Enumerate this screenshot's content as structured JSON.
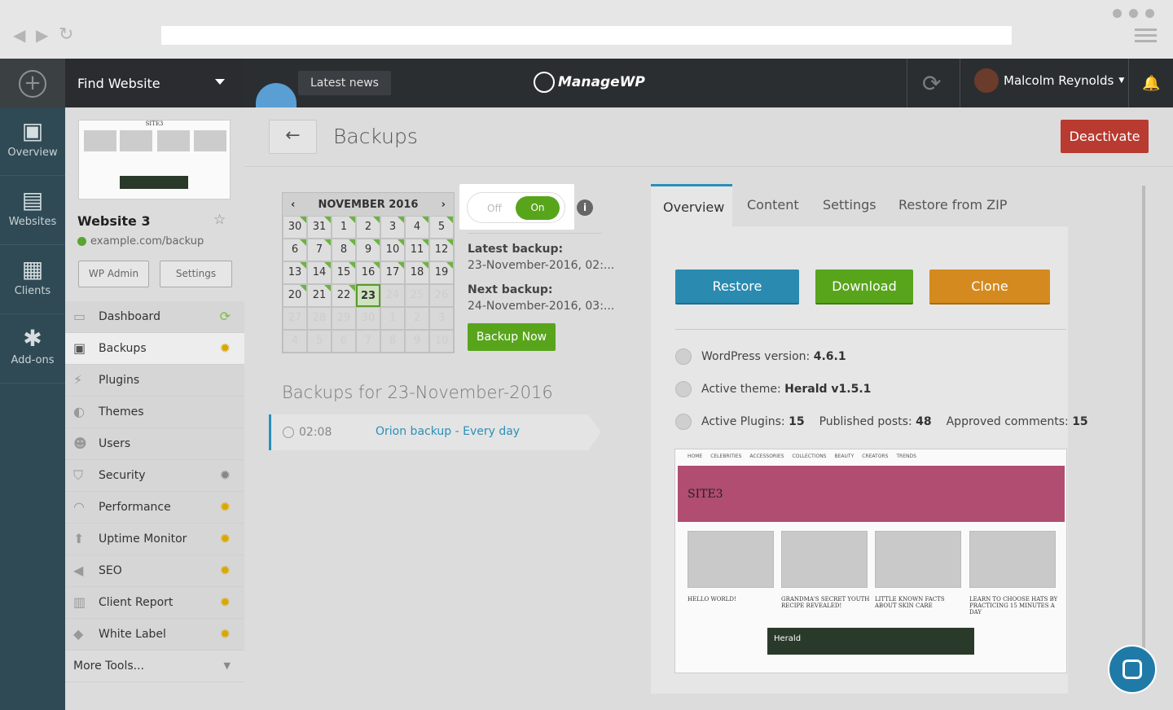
{
  "browser": {
    "back_icon": "◀",
    "forward_icon": "▶",
    "reload_icon": "↻"
  },
  "topbar": {
    "find_website": "Find Website",
    "latest_news": "Latest news",
    "logo_text": "ManageWP",
    "user_name": "Malcolm Reynolds"
  },
  "rail": [
    {
      "label": "Overview",
      "icon": "monitor-chart-icon"
    },
    {
      "label": "Websites",
      "icon": "websites-list-icon"
    },
    {
      "label": "Clients",
      "icon": "clients-icon"
    },
    {
      "label": "Add-ons",
      "icon": "star-badge-icon"
    }
  ],
  "site": {
    "name": "Website 3",
    "url": "example.com/backup",
    "wp_admin": "WP Admin",
    "settings": "Settings",
    "thumb_title": "SITE3"
  },
  "menu": [
    {
      "label": "Dashboard",
      "badge": "sync"
    },
    {
      "label": "Backups",
      "badge": "gear"
    },
    {
      "label": "Plugins",
      "badge": ""
    },
    {
      "label": "Themes",
      "badge": ""
    },
    {
      "label": "Users",
      "badge": ""
    },
    {
      "label": "Security",
      "badge": "gear-grey"
    },
    {
      "label": "Performance",
      "badge": "gear"
    },
    {
      "label": "Uptime Monitor",
      "badge": "gear"
    },
    {
      "label": "SEO",
      "badge": "gear"
    },
    {
      "label": "Client Report",
      "badge": "gear"
    },
    {
      "label": "White Label",
      "badge": "gear"
    }
  ],
  "more_tools": "More Tools...",
  "page": {
    "title": "Backups",
    "deactivate": "Deactivate"
  },
  "calendar": {
    "month": "NOVEMBER 2016",
    "rows": [
      [
        "30",
        "31",
        "1",
        "2",
        "3",
        "4",
        "5"
      ],
      [
        "6",
        "7",
        "8",
        "9",
        "10",
        "11",
        "12"
      ],
      [
        "13",
        "14",
        "15",
        "16",
        "17",
        "18",
        "19"
      ],
      [
        "20",
        "21",
        "22",
        "23",
        "24",
        "25",
        "26"
      ],
      [
        "27",
        "28",
        "29",
        "30",
        "1",
        "2",
        "3"
      ],
      [
        "4",
        "5",
        "6",
        "7",
        "8",
        "9",
        "10"
      ]
    ],
    "selected": "23"
  },
  "toggle": {
    "off": "Off",
    "on": "On"
  },
  "latest_backup": {
    "label": "Latest backup:",
    "value": "23-November-2016, 02:..."
  },
  "next_backup": {
    "label": "Next backup:",
    "value": "24-November-2016, 03:..."
  },
  "backup_now": "Backup Now",
  "backups_for": "Backups for 23-November-2016",
  "backup_entry": {
    "time": "02:08",
    "name": "Orion backup - Every day"
  },
  "tabs": [
    "Overview",
    "Content",
    "Settings",
    "Restore from ZIP"
  ],
  "actions": {
    "restore": "Restore",
    "download": "Download",
    "clone": "Clone"
  },
  "stats": {
    "wp_label": "WordPress version:",
    "wp_value": "4.6.1",
    "theme_label": "Active theme:",
    "theme_value": "Herald v1.5.1",
    "plugins_label": "Active Plugins:",
    "plugins_value": "15",
    "posts_label": "Published posts:",
    "posts_value": "48",
    "comments_label": "Approved comments:",
    "comments_value": "15"
  },
  "preview": {
    "nav": [
      "HOME",
      "CELEBRITIES",
      "ACCESSORIES",
      "COLLECTIONS",
      "BEAUTY",
      "CREATORS",
      "TRENDS"
    ],
    "hero": "SITE3",
    "titles": [
      "HELLO WORLD!",
      "GRANDMA'S SECRET YOUTH RECIPE REVEALED!",
      "LITTLE KNOWN FACTS ABOUT SKIN CARE",
      "LEARN TO CHOOSE HATS BY PRACTICING 15 MINUTES A DAY"
    ],
    "ad": "Herald"
  },
  "colors": {
    "accent": "#2b8fb8",
    "green": "#58a51c",
    "deactivate": "#b93a30",
    "clone": "#d48a1f"
  }
}
